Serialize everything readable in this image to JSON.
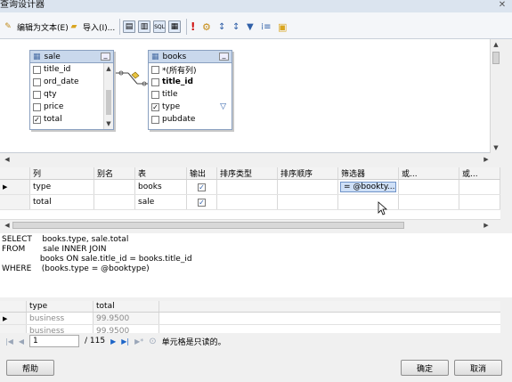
{
  "window": {
    "title": "查询设计器"
  },
  "toolbar": {
    "edit_as_text": "编辑为文本(E)",
    "import": "导入(I)..."
  },
  "tables": [
    {
      "name": "sale",
      "fields": [
        {
          "label": "title_id",
          "checked": false,
          "bold": false
        },
        {
          "label": "ord_date",
          "checked": false,
          "bold": false
        },
        {
          "label": "qty",
          "checked": false,
          "bold": false
        },
        {
          "label": "price",
          "checked": false,
          "bold": false
        },
        {
          "label": "total",
          "checked": true,
          "bold": false
        }
      ]
    },
    {
      "name": "books",
      "fields": [
        {
          "label": "*(所有列)",
          "checked": false,
          "bold": false
        },
        {
          "label": "title_id",
          "checked": false,
          "bold": true
        },
        {
          "label": "title",
          "checked": false,
          "bold": false
        },
        {
          "label": "type",
          "checked": true,
          "bold": false
        },
        {
          "label": "pubdate",
          "checked": false,
          "bold": false
        }
      ]
    }
  ],
  "grid": {
    "headers": [
      "列",
      "别名",
      "表",
      "输出",
      "排序类型",
      "排序顺序",
      "筛选器",
      "或...",
      "或..."
    ],
    "rows": [
      {
        "column": "type",
        "alias": "",
        "table": "books",
        "output": true,
        "filter": "= @bookty..."
      },
      {
        "column": "total",
        "alias": "",
        "table": "sale",
        "output": true,
        "filter": ""
      }
    ]
  },
  "sql": {
    "l1": "SELECT    books.type, sale.total",
    "l2": "FROM       sale INNER JOIN",
    "l3": "               books ON sale.title_id = books.title_id",
    "l4": "WHERE    (books.type = @booktype)"
  },
  "results": {
    "headers": [
      "type",
      "total"
    ],
    "rows": [
      {
        "type": "business",
        "total": "99.9500"
      },
      {
        "type": "business",
        "total": "99.9500"
      }
    ]
  },
  "navigator": {
    "current": "1",
    "total": "/ 115",
    "status": "单元格是只读的。"
  },
  "buttons": {
    "help": "帮助",
    "ok": "确定",
    "cancel": "取消"
  }
}
